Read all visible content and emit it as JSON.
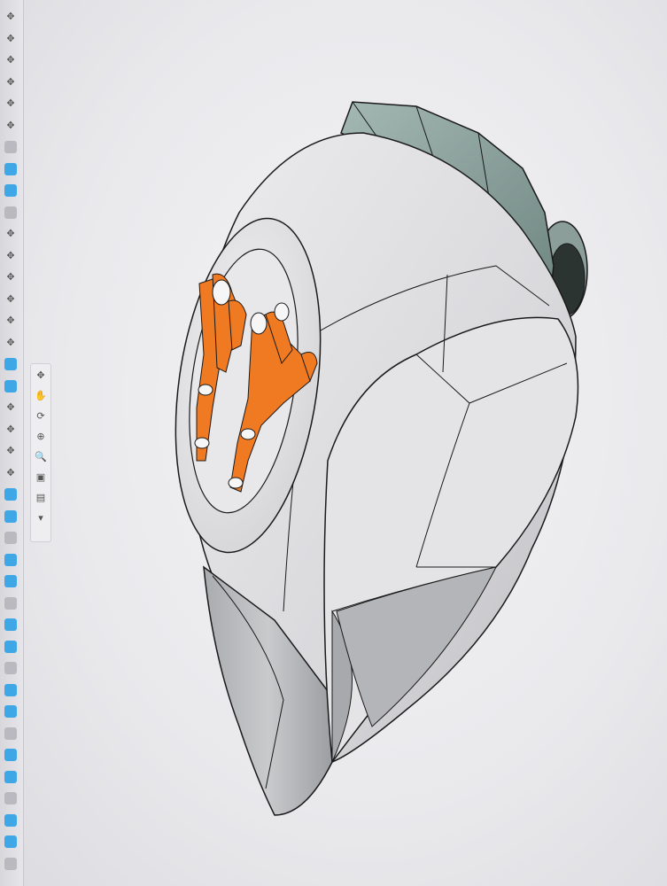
{
  "app": {
    "view": "3D model viewport"
  },
  "left_toolbar": {
    "icons": [
      "move-icon",
      "move-icon",
      "move-icon",
      "move-icon",
      "move-icon",
      "move-icon",
      "part-icon",
      "part-icon",
      "part-icon",
      "part-icon",
      "move-icon",
      "move-icon",
      "move-icon",
      "move-icon",
      "move-icon",
      "move-icon",
      "part-icon",
      "part-icon",
      "move-icon",
      "move-icon",
      "move-icon",
      "move-icon",
      "part-icon",
      "part-icon",
      "part-icon",
      "part-icon",
      "part-icon",
      "part-icon",
      "part-icon",
      "part-icon",
      "part-icon",
      "part-icon",
      "part-icon",
      "part-icon",
      "part-icon",
      "part-icon",
      "part-icon",
      "part-icon",
      "part-icon",
      "part-icon"
    ]
  },
  "view_toolbar": {
    "icons": [
      "orbit-icon",
      "pan-icon",
      "rotate-icon",
      "zoom-fit-icon",
      "zoom-icon",
      "view-cube-icon",
      "display-mode-icon",
      "settings-icon"
    ]
  },
  "model": {
    "name": "",
    "body_color": "#e3e3e6",
    "accent_color": "#f07a22",
    "visor_color": "#8fa6a1",
    "edge_color": "#1a1a1a"
  }
}
